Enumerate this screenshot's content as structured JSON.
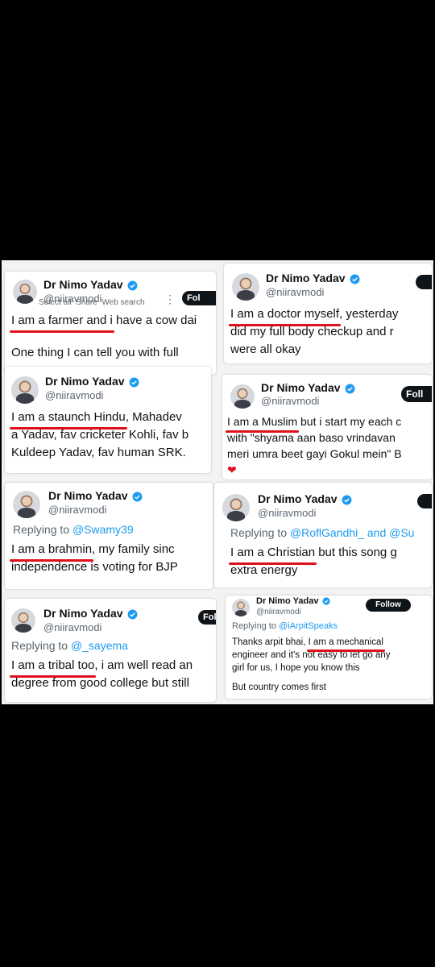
{
  "author": {
    "name": "Dr Nimo Yadav",
    "handle": "@niiravmodi"
  },
  "follow_label": "Fol",
  "follow_label_short": "Foll",
  "follow_label_full": "Follow",
  "reply_prefix": "Replying to",
  "popup": {
    "select_all": "Select all",
    "share": "Share",
    "web_search": "Web search"
  },
  "cards": [
    {
      "id": "farmer",
      "highlight": "I am a farmer and i",
      "line1_rest": " have a cow dai",
      "line2": "One thing I can tell you with full",
      "line3": "...(cut off)..."
    },
    {
      "id": "doctor",
      "highlight": "I am a doctor myself",
      "line1_rest": ", yesterday",
      "line2": "did my full body checkup and r",
      "line3": "were all okay"
    },
    {
      "id": "hindu",
      "highlight": "I am a staunch Hindu",
      "line1_rest": ", Mahadev",
      "line2": "a Yadav, fav cricketer Kohli, fav b",
      "line3": "Kuldeep Yadav, fav human SRK."
    },
    {
      "id": "muslim",
      "highlight": "I am a Muslim",
      "line1_rest": " but i start my each c",
      "line2": "with \"shyama aan baso vrindavan",
      "line3": "meri umra beet gayi Gokul mein\" B",
      "emoji": "❤"
    },
    {
      "id": "brahmin",
      "reply_to": "@Swamy39",
      "highlight": "I am a brahmin",
      "line1_rest": ", my family sinc",
      "line2": "independence is voting for BJP"
    },
    {
      "id": "christian",
      "reply_to": "@RoflGandhi_",
      "reply_and": "and",
      "reply_to2": "@Su",
      "highlight": "I am a Christian",
      "line1_rest": " but this song g",
      "line2": "extra energy"
    },
    {
      "id": "tribal",
      "reply_to": "@_sayema",
      "highlight": "I am a tribal too",
      "line1_rest": ", i am well read an",
      "line2": "degree from good college but still"
    },
    {
      "id": "engineer",
      "reply_to": "@iArpitSpeaks",
      "line1_pre": "Thanks arpit bhai, ",
      "highlight": "I am a mechanical",
      "line2": "engineer and it's not easy to let go any",
      "line3": "girl  for us, I hope you know this",
      "line4": "But country comes first"
    }
  ],
  "colors": {
    "accent_red": "#e0101a",
    "link_blue": "#1d9bf0",
    "verified_blue": "#1d9bf0"
  }
}
